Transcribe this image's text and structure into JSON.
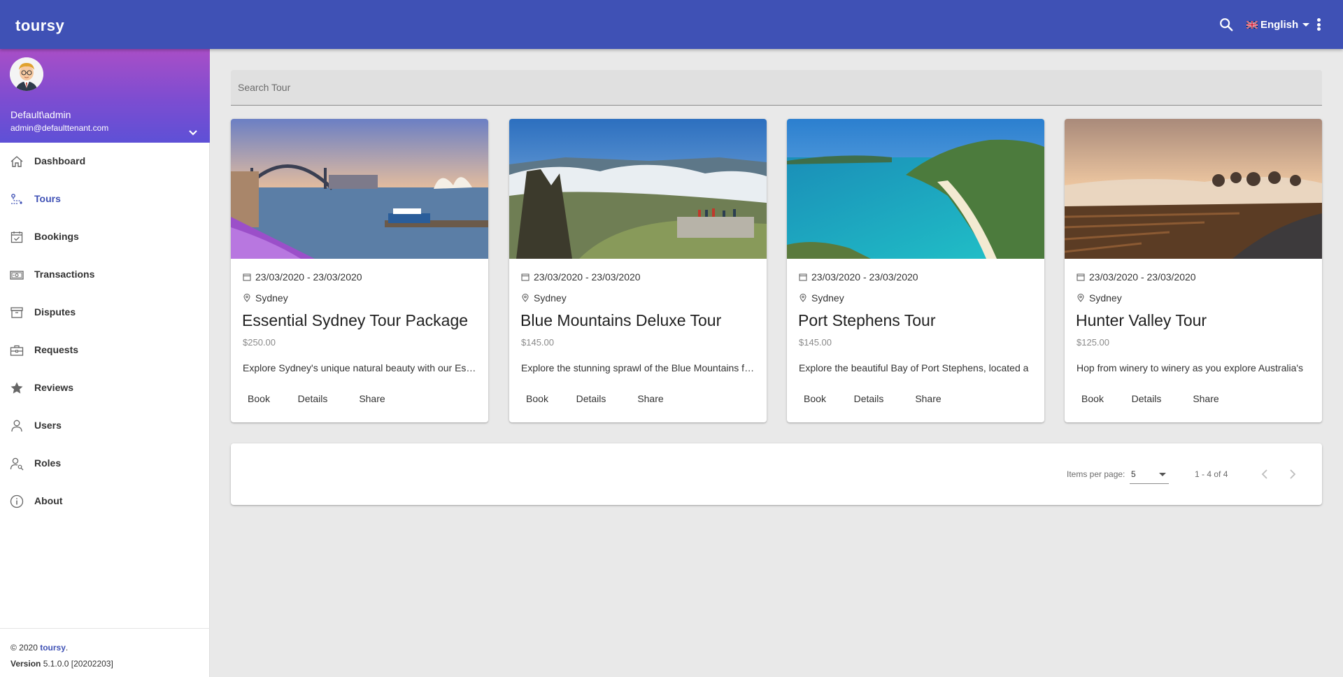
{
  "app": {
    "brand": "toursy"
  },
  "topbar": {
    "language": "English"
  },
  "profile": {
    "name": "Default\\admin",
    "email": "admin@defaulttenant.com"
  },
  "sidebar": {
    "items": [
      {
        "label": "Dashboard",
        "icon": "home-icon",
        "active": false
      },
      {
        "label": "Tours",
        "icon": "tour-route-icon",
        "active": true
      },
      {
        "label": "Bookings",
        "icon": "calendar-check-icon",
        "active": false
      },
      {
        "label": "Transactions",
        "icon": "money-icon",
        "active": false
      },
      {
        "label": "Disputes",
        "icon": "archive-box-icon",
        "active": false
      },
      {
        "label": "Requests",
        "icon": "briefcase-icon",
        "active": false
      },
      {
        "label": "Reviews",
        "icon": "star-icon",
        "active": false
      },
      {
        "label": "Users",
        "icon": "person-icon",
        "active": false
      },
      {
        "label": "Roles",
        "icon": "person-key-icon",
        "active": false
      },
      {
        "label": "About",
        "icon": "info-icon",
        "active": false
      }
    ]
  },
  "footer": {
    "copyright": "© 2020",
    "brand_link": "toursy",
    "period": ".",
    "version_label": "Version",
    "version_value": "5.1.0.0 [20202203]"
  },
  "search": {
    "placeholder": "Search Tour"
  },
  "cards": [
    {
      "date": "23/03/2020 - 23/03/2020",
      "location": "Sydney",
      "title": "Essential Sydney Tour Package",
      "price": "$250.00",
      "description": "Explore Sydney's unique natural beauty with our Essential Sydney Tour Package",
      "book": "Book",
      "details": "Details",
      "share": "Share"
    },
    {
      "date": "23/03/2020 - 23/03/2020",
      "location": "Sydney",
      "title": "Blue Mountains Deluxe Tour",
      "price": "$145.00",
      "description": "Explore the stunning sprawl of the Blue Mountains from",
      "book": "Book",
      "details": "Details",
      "share": "Share"
    },
    {
      "date": "23/03/2020 - 23/03/2020",
      "location": "Sydney",
      "title": "Port Stephens Tour",
      "price": "$145.00",
      "description": "Explore the beautiful Bay of Port Stephens, located a",
      "book": "Book",
      "details": "Details",
      "share": "Share"
    },
    {
      "date": "23/03/2020 - 23/03/2020",
      "location": "Sydney",
      "title": "Hunter Valley Tour",
      "price": "$125.00",
      "description": "Hop from winery to winery as you explore Australia's",
      "book": "Book",
      "details": "Details",
      "share": "Share"
    }
  ],
  "paginator": {
    "items_per_page_label": "Items per page:",
    "items_per_page_value": "5",
    "range": "1 - 4 of 4"
  },
  "colors": {
    "primary": "#3f51b5",
    "profile_gradient_top": "#a94ec7",
    "profile_gradient_bottom": "#5e50d6",
    "background": "#e9e9e9"
  }
}
